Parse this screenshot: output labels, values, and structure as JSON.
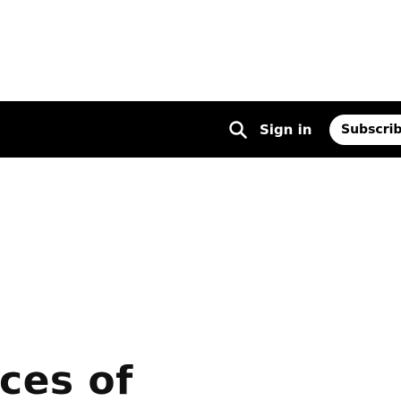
{
  "header": {
    "search_icon": "search-icon",
    "signin_label": "Sign in",
    "subscribe_label": "Subscribe",
    "bar_color": "#000000"
  },
  "article": {
    "headline_fragment": "ces of"
  }
}
